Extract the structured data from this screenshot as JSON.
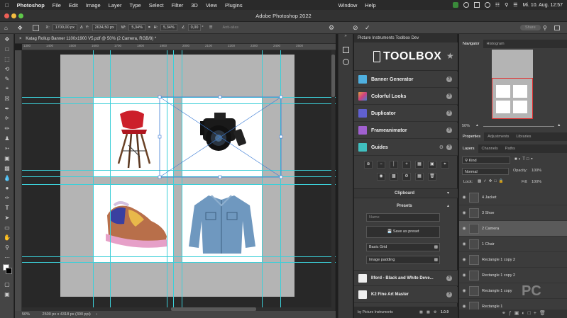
{
  "menubar": {
    "apple_icon": "apple-icon",
    "items": [
      "Photoshop",
      "File",
      "Edit",
      "Image",
      "Layer",
      "Type",
      "Select",
      "Filter",
      "3D",
      "View",
      "Plugins",
      "Window",
      "Help"
    ],
    "clock": "Mi. 10. Aug.  12:57"
  },
  "window": {
    "title": "Adobe Photoshop 2022"
  },
  "options": {
    "x_label": "X:",
    "x_value": "1700,00 px",
    "y_label": "Y:",
    "y_value": "2634,50 px",
    "w_label": "W:",
    "w_value": "5,34%",
    "h_label": "H:",
    "h_value": "5,34%",
    "angle_value": "0,00",
    "angle_unit": "°",
    "antialias_label": "Anti-alias",
    "share_label": "Share"
  },
  "document": {
    "tab_title": "Katag Rollup Banner 1100x1900 V5.pdf @ 50% (2 Camera, RGB/8) *",
    "zoom": "50%",
    "doc_info": "2500 px x 4318 px (300 ppi)",
    "ruler_ticks": [
      "1300",
      "1400",
      "1500",
      "1600",
      "1700",
      "1800",
      "1900",
      "2000",
      "2100",
      "2200",
      "2300",
      "2400",
      "2500"
    ]
  },
  "plugin": {
    "panel_title": "Picture Instruments Toolbox Dev",
    "logo_text": "TOOLBOX",
    "items": [
      {
        "label": "Banner Generator",
        "color": "#4fb0e0"
      },
      {
        "label": "Colorful Looks",
        "color": "#e0a040"
      },
      {
        "label": "Duplicator",
        "color": "#6060d0"
      },
      {
        "label": "Frameanimator",
        "color": "#a060d0"
      },
      {
        "label": "Guides",
        "color": "#40c0c0"
      }
    ],
    "clipboard_label": "Clipboard",
    "presets_label": "Presets",
    "name_placeholder": "Name",
    "save_preset_label": "Save as preset",
    "presets": [
      "Basic Grid",
      "Image padding"
    ],
    "extra_items": [
      {
        "label": "Ilford - Black and White Deve..."
      },
      {
        "label": "K2 Fine Art Master"
      }
    ],
    "footer_text": "by Picture Instruments",
    "version": "1.0.9"
  },
  "navigator": {
    "tabs": [
      "Navigator",
      "Histogram"
    ],
    "zoom": "50%"
  },
  "properties_tabs": [
    "Properties",
    "Adjustments",
    "Libraries"
  ],
  "layers_panel": {
    "tabs": [
      "Layers",
      "Channels",
      "Paths"
    ],
    "kind_label": "Kind",
    "blend_mode": "Normal",
    "opacity_label": "Opacity:",
    "opacity_value": "100%",
    "lock_label": "Lock:",
    "fill_label": "Fill:",
    "fill_value": "100%",
    "layers": [
      {
        "name": "4 Jacket"
      },
      {
        "name": "3 Shoe"
      },
      {
        "name": "2 Camera"
      },
      {
        "name": "1 Chair"
      },
      {
        "name": "Rectangle 1 copy 2"
      },
      {
        "name": "Rectangle 1 copy 2"
      },
      {
        "name": "Rectangle 1 copy"
      },
      {
        "name": "Rectangle 1"
      }
    ]
  },
  "watermark": "PC",
  "colors": {
    "guide": "#3ccfd8",
    "selected_layer": "#5a5a5a"
  }
}
